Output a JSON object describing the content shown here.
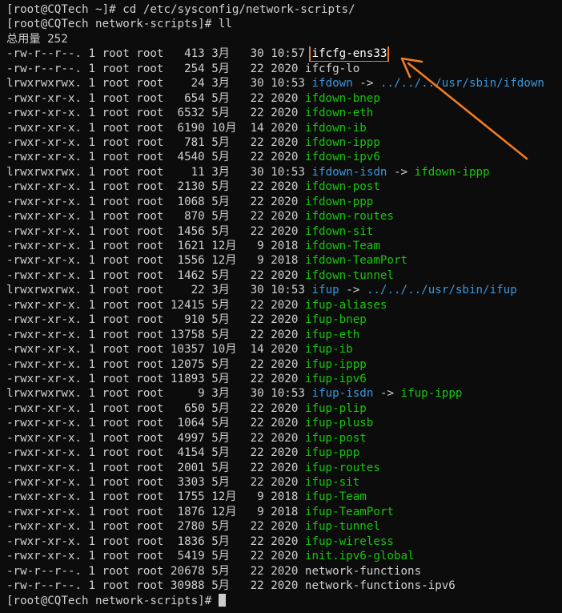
{
  "terminal": {
    "background": "#0c0c0c",
    "colors": {
      "text": "#cccccc",
      "executable": "#16c60c",
      "symlink": "#3a96dd",
      "annotation": "#f07c21"
    },
    "lines": [
      {
        "segments": [
          {
            "t": "[root@CQTech ~]# cd /etc/sysconfig/network-scripts/",
            "c": "w"
          }
        ]
      },
      {
        "segments": [
          {
            "t": "[root@CQTech network-scripts]# ll",
            "c": "w"
          }
        ]
      },
      {
        "segments": [
          {
            "t": "总用量 252",
            "c": "w"
          }
        ]
      },
      {
        "segments": [
          {
            "t": "-rw-r--r--. 1 root root   413 3月   30 10:57 ",
            "c": "w"
          },
          {
            "t": "ifcfg-ens33",
            "c": "w",
            "boxed": true
          }
        ]
      },
      {
        "segments": [
          {
            "t": "-rw-r--r--. 1 root root   254 5月   22 2020 ifcfg-lo",
            "c": "w"
          }
        ]
      },
      {
        "segments": [
          {
            "t": "lrwxrwxrwx. 1 root root    24 3月   30 10:53 ",
            "c": "w"
          },
          {
            "t": "ifdown",
            "c": "c"
          },
          {
            "t": " -> ",
            "c": "w"
          },
          {
            "t": "../../../usr/sbin/ifdown",
            "c": "c"
          }
        ]
      },
      {
        "segments": [
          {
            "t": "-rwxr-xr-x. 1 root root   654 5月   22 2020 ",
            "c": "w"
          },
          {
            "t": "ifdown-bnep",
            "c": "g"
          }
        ]
      },
      {
        "segments": [
          {
            "t": "-rwxr-xr-x. 1 root root  6532 5月   22 2020 ",
            "c": "w"
          },
          {
            "t": "ifdown-eth",
            "c": "g"
          }
        ]
      },
      {
        "segments": [
          {
            "t": "-rwxr-xr-x. 1 root root  6190 10月  14 2020 ",
            "c": "w"
          },
          {
            "t": "ifdown-ib",
            "c": "g"
          }
        ]
      },
      {
        "segments": [
          {
            "t": "-rwxr-xr-x. 1 root root   781 5月   22 2020 ",
            "c": "w"
          },
          {
            "t": "ifdown-ippp",
            "c": "g"
          }
        ]
      },
      {
        "segments": [
          {
            "t": "-rwxr-xr-x. 1 root root  4540 5月   22 2020 ",
            "c": "w"
          },
          {
            "t": "ifdown-ipv6",
            "c": "g"
          }
        ]
      },
      {
        "segments": [
          {
            "t": "lrwxrwxrwx. 1 root root    11 3月   30 10:53 ",
            "c": "w"
          },
          {
            "t": "ifdown-isdn",
            "c": "c"
          },
          {
            "t": " -> ",
            "c": "w"
          },
          {
            "t": "ifdown-ippp",
            "c": "g"
          }
        ]
      },
      {
        "segments": [
          {
            "t": "-rwxr-xr-x. 1 root root  2130 5月   22 2020 ",
            "c": "w"
          },
          {
            "t": "ifdown-post",
            "c": "g"
          }
        ]
      },
      {
        "segments": [
          {
            "t": "-rwxr-xr-x. 1 root root  1068 5月   22 2020 ",
            "c": "w"
          },
          {
            "t": "ifdown-ppp",
            "c": "g"
          }
        ]
      },
      {
        "segments": [
          {
            "t": "-rwxr-xr-x. 1 root root   870 5月   22 2020 ",
            "c": "w"
          },
          {
            "t": "ifdown-routes",
            "c": "g"
          }
        ]
      },
      {
        "segments": [
          {
            "t": "-rwxr-xr-x. 1 root root  1456 5月   22 2020 ",
            "c": "w"
          },
          {
            "t": "ifdown-sit",
            "c": "g"
          }
        ]
      },
      {
        "segments": [
          {
            "t": "-rwxr-xr-x. 1 root root  1621 12月   9 2018 ",
            "c": "w"
          },
          {
            "t": "ifdown-Team",
            "c": "g"
          }
        ]
      },
      {
        "segments": [
          {
            "t": "-rwxr-xr-x. 1 root root  1556 12月   9 2018 ",
            "c": "w"
          },
          {
            "t": "ifdown-TeamPort",
            "c": "g"
          }
        ]
      },
      {
        "segments": [
          {
            "t": "-rwxr-xr-x. 1 root root  1462 5月   22 2020 ",
            "c": "w"
          },
          {
            "t": "ifdown-tunnel",
            "c": "g"
          }
        ]
      },
      {
        "segments": [
          {
            "t": "lrwxrwxrwx. 1 root root    22 3月   30 10:53 ",
            "c": "w"
          },
          {
            "t": "ifup",
            "c": "c"
          },
          {
            "t": " -> ",
            "c": "w"
          },
          {
            "t": "../../../usr/sbin/ifup",
            "c": "c"
          }
        ]
      },
      {
        "segments": [
          {
            "t": "-rwxr-xr-x. 1 root root 12415 5月   22 2020 ",
            "c": "w"
          },
          {
            "t": "ifup-aliases",
            "c": "g"
          }
        ]
      },
      {
        "segments": [
          {
            "t": "-rwxr-xr-x. 1 root root   910 5月   22 2020 ",
            "c": "w"
          },
          {
            "t": "ifup-bnep",
            "c": "g"
          }
        ]
      },
      {
        "segments": [
          {
            "t": "-rwxr-xr-x. 1 root root 13758 5月   22 2020 ",
            "c": "w"
          },
          {
            "t": "ifup-eth",
            "c": "g"
          }
        ]
      },
      {
        "segments": [
          {
            "t": "-rwxr-xr-x. 1 root root 10357 10月  14 2020 ",
            "c": "w"
          },
          {
            "t": "ifup-ib",
            "c": "g"
          }
        ]
      },
      {
        "segments": [
          {
            "t": "-rwxr-xr-x. 1 root root 12075 5月   22 2020 ",
            "c": "w"
          },
          {
            "t": "ifup-ippp",
            "c": "g"
          }
        ]
      },
      {
        "segments": [
          {
            "t": "-rwxr-xr-x. 1 root root 11893 5月   22 2020 ",
            "c": "w"
          },
          {
            "t": "ifup-ipv6",
            "c": "g"
          }
        ]
      },
      {
        "segments": [
          {
            "t": "lrwxrwxrwx. 1 root root     9 3月   30 10:53 ",
            "c": "w"
          },
          {
            "t": "ifup-isdn",
            "c": "c"
          },
          {
            "t": " -> ",
            "c": "w"
          },
          {
            "t": "ifup-ippp",
            "c": "g"
          }
        ]
      },
      {
        "segments": [
          {
            "t": "-rwxr-xr-x. 1 root root   650 5月   22 2020 ",
            "c": "w"
          },
          {
            "t": "ifup-plip",
            "c": "g"
          }
        ]
      },
      {
        "segments": [
          {
            "t": "-rwxr-xr-x. 1 root root  1064 5月   22 2020 ",
            "c": "w"
          },
          {
            "t": "ifup-plusb",
            "c": "g"
          }
        ]
      },
      {
        "segments": [
          {
            "t": "-rwxr-xr-x. 1 root root  4997 5月   22 2020 ",
            "c": "w"
          },
          {
            "t": "ifup-post",
            "c": "g"
          }
        ]
      },
      {
        "segments": [
          {
            "t": "-rwxr-xr-x. 1 root root  4154 5月   22 2020 ",
            "c": "w"
          },
          {
            "t": "ifup-ppp",
            "c": "g"
          }
        ]
      },
      {
        "segments": [
          {
            "t": "-rwxr-xr-x. 1 root root  2001 5月   22 2020 ",
            "c": "w"
          },
          {
            "t": "ifup-routes",
            "c": "g"
          }
        ]
      },
      {
        "segments": [
          {
            "t": "-rwxr-xr-x. 1 root root  3303 5月   22 2020 ",
            "c": "w"
          },
          {
            "t": "ifup-sit",
            "c": "g"
          }
        ]
      },
      {
        "segments": [
          {
            "t": "-rwxr-xr-x. 1 root root  1755 12月   9 2018 ",
            "c": "w"
          },
          {
            "t": "ifup-Team",
            "c": "g"
          }
        ]
      },
      {
        "segments": [
          {
            "t": "-rwxr-xr-x. 1 root root  1876 12月   9 2018 ",
            "c": "w"
          },
          {
            "t": "ifup-TeamPort",
            "c": "g"
          }
        ]
      },
      {
        "segments": [
          {
            "t": "-rwxr-xr-x. 1 root root  2780 5月   22 2020 ",
            "c": "w"
          },
          {
            "t": "ifup-tunnel",
            "c": "g"
          }
        ]
      },
      {
        "segments": [
          {
            "t": "-rwxr-xr-x. 1 root root  1836 5月   22 2020 ",
            "c": "w"
          },
          {
            "t": "ifup-wireless",
            "c": "g"
          }
        ]
      },
      {
        "segments": [
          {
            "t": "-rwxr-xr-x. 1 root root  5419 5月   22 2020 ",
            "c": "w"
          },
          {
            "t": "init.ipv6-global",
            "c": "g"
          }
        ]
      },
      {
        "segments": [
          {
            "t": "-rw-r--r--. 1 root root 20678 5月   22 2020 network-functions",
            "c": "w"
          }
        ]
      },
      {
        "segments": [
          {
            "t": "-rw-r--r--. 1 root root 30988 5月   22 2020 network-functions-ipv6",
            "c": "w"
          }
        ]
      },
      {
        "segments": [
          {
            "t": "[root@CQTech network-scripts]# ",
            "c": "w"
          }
        ],
        "cursor": true
      }
    ]
  }
}
